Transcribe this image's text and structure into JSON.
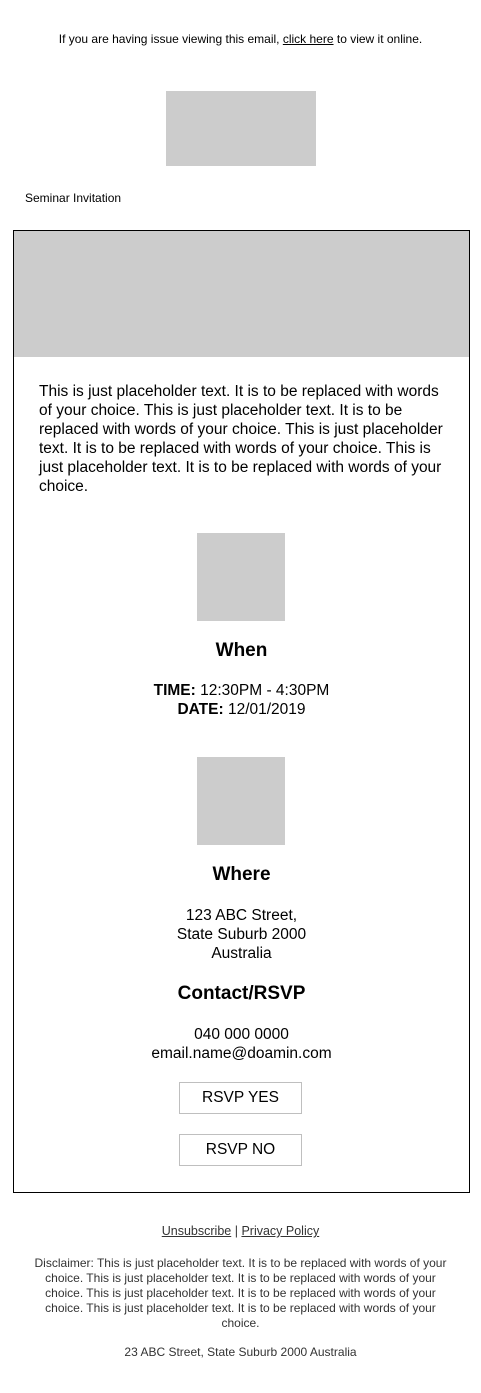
{
  "preheader": {
    "before": "If you are having issue viewing this email, ",
    "link": "click here",
    "after": " to view it online."
  },
  "subject_label": "Seminar Invitation",
  "intro": "This is just placeholder text. It is to be replaced with words of your choice. This is just placeholder text. It is to be replaced with words of your choice. This is just placeholder text. It is to be replaced with words of your choice. This is just placeholder text. It is to be replaced with words of your choice.",
  "when": {
    "heading": "When",
    "time_label": "TIME:",
    "time_value": " 12:30PM - 4:30PM",
    "date_label": "DATE:",
    "date_value": " 12/01/2019"
  },
  "where": {
    "heading": "Where",
    "line1": "123 ABC Street,",
    "line2": "State Suburb 2000",
    "line3": "Australia"
  },
  "contact": {
    "heading": "Contact/RSVP",
    "phone": "040 000 0000",
    "email": "email.name@doamin.com"
  },
  "buttons": {
    "rsvp_yes": "RSVP YES",
    "rsvp_no": "RSVP NO"
  },
  "footer": {
    "unsubscribe": "Unsubscribe",
    "separator": " | ",
    "privacy": "Privacy Policy",
    "disclaimer": "Disclaimer: This is just placeholder text. It is to be replaced with words of your choice. This is just placeholder text. It is to be replaced with words of your choice. This is just placeholder text. It is to be replaced with words of your choice. This is just placeholder text. It is to be replaced with words of your choice.",
    "address": "23 ABC Street, State Suburb 2000 Australia"
  },
  "colors": {
    "placeholder": "#cccccc",
    "border": "#000000",
    "button_border": "#bfbfbf",
    "footer_text": "#333333"
  }
}
